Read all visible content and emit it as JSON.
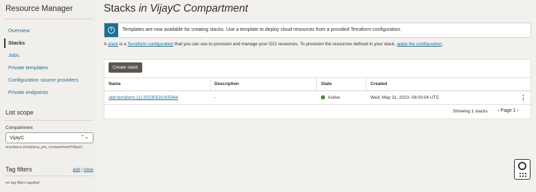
{
  "sidebar": {
    "app_title": "Resource Manager",
    "items": [
      {
        "label": "Overview"
      },
      {
        "label": "Stacks"
      },
      {
        "label": "Jobs"
      },
      {
        "label": "Private templates"
      },
      {
        "label": "Configuration source providers"
      },
      {
        "label": "Private endpoints"
      }
    ],
    "active_item": "Stacks",
    "list_scope_heading": "List scope",
    "compartment_label": "Compartment",
    "compartment_value": "VijayC",
    "compartment_path": "oraclepca (root)/pca_pm_compartment/VijayC",
    "tag_filters_heading": "Tag filters",
    "tag_add": "add",
    "tag_separator": "|",
    "tag_clear": "clear",
    "tag_empty": "no tag filters applied"
  },
  "header": {
    "title": "Stacks",
    "title_suffix": "in VijayC Compartment"
  },
  "banner": {
    "icon": "info-icon",
    "text": "Templates are now available for creating stacks. Use a template to deploy cloud resources from a provided Terraform configuration."
  },
  "description": {
    "part1": "A ",
    "link1": "stack",
    "part2": " is a ",
    "link2": "Terraform configuration",
    "part3": " that you can use to provision and manage your OCI resources. To provision the resources defined in your stack, ",
    "link3": "apply the configuration",
    "part4": "."
  },
  "table": {
    "create_button": "Create stack",
    "columns": [
      "Name",
      "Description",
      "State",
      "Created"
    ],
    "rows": [
      {
        "name": "okit-terraform (1)-20230531005944",
        "description": "-",
        "state": "Active",
        "created": "Wed, May 31, 2023, 08:00:04 UTC"
      }
    ],
    "showing": "Showing 1 stacks",
    "page_label": "Page 1",
    "prev": "‹",
    "next": "›"
  },
  "colors": {
    "accent": "#1f6d94",
    "active_state": "#4b8a2f",
    "button_bg": "#5b5652"
  }
}
